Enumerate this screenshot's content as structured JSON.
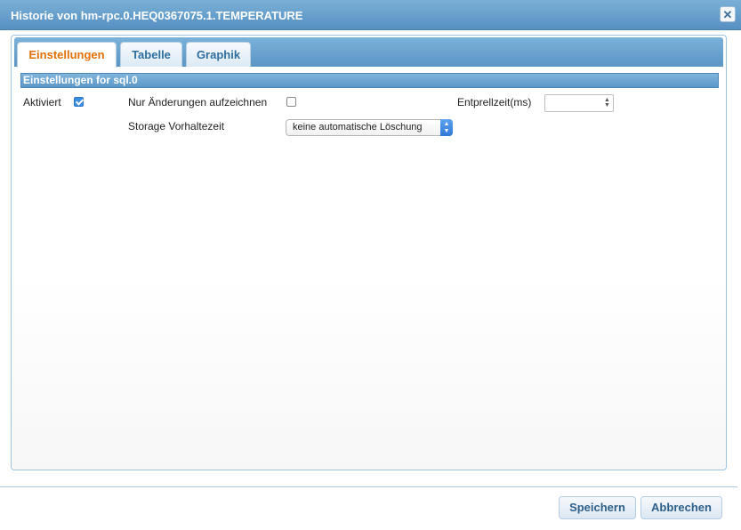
{
  "dialog": {
    "title": "Historie von hm-rpc.0.HEQ0367075.1.TEMPERATURE",
    "close_icon": "✕"
  },
  "tabs": [
    {
      "label": "Einstellungen",
      "active": true
    },
    {
      "label": "Tabelle",
      "active": false
    },
    {
      "label": "Graphik",
      "active": false
    }
  ],
  "settings": {
    "header": "Einstellungen for sql.0",
    "enabled_label": "Aktiviert",
    "enabled": true,
    "changes_only_label": "Nur Änderungen aufzeichnen",
    "changes_only": false,
    "debounce_label": "Entprellzeit(ms)",
    "debounce_value": "",
    "retention_label": "Storage Vorhaltezeit",
    "retention_value": "keine automatische Löschung"
  },
  "footer": {
    "save_label": "Speichern",
    "cancel_label": "Abbrechen"
  }
}
